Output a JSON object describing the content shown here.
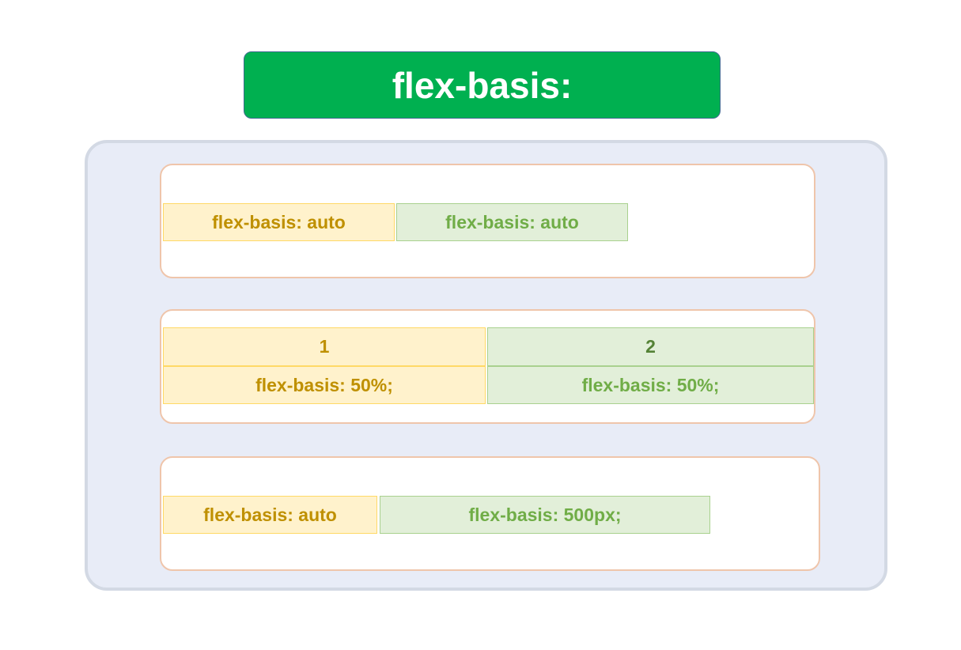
{
  "title": "flex-basis:",
  "rows": [
    {
      "items": [
        {
          "label": "flex-basis: auto",
          "color": "yellow"
        },
        {
          "label": "flex-basis: auto",
          "color": "green"
        }
      ]
    },
    {
      "items": [
        {
          "index": "1",
          "label": "flex-basis: 50%;",
          "color": "yellow"
        },
        {
          "index": "2",
          "label": "flex-basis: 50%;",
          "color": "green"
        }
      ]
    },
    {
      "items": [
        {
          "label": "flex-basis: auto",
          "color": "yellow"
        },
        {
          "label": "flex-basis: 500px;",
          "color": "green"
        }
      ]
    }
  ],
  "colors": {
    "title_bg": "#00b050",
    "panel_bg": "#e8ecf7",
    "row_border": "#efc5ab",
    "yellow_fill": "#fff2cc",
    "yellow_border": "#ffd966",
    "yellow_text": "#bf9000",
    "green_fill": "#e2efd9",
    "green_border": "#a9d18e",
    "green_text": "#70ad47"
  }
}
